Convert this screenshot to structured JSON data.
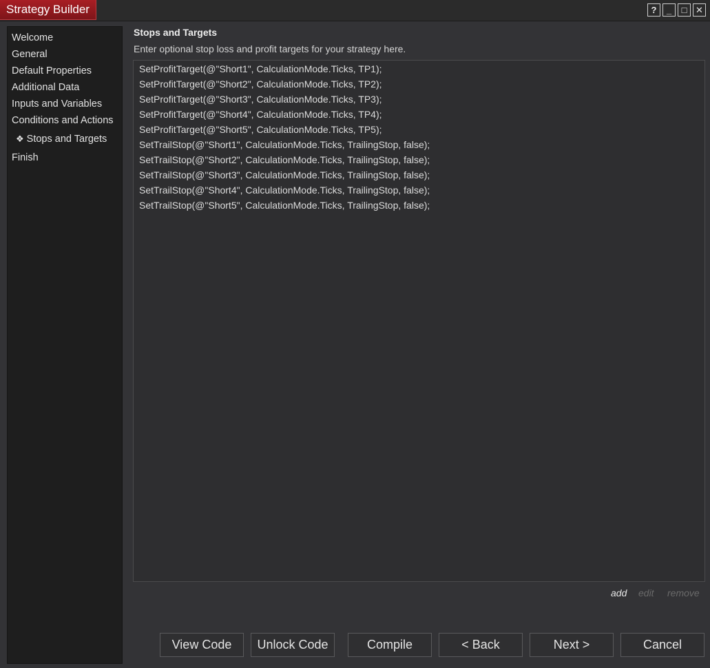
{
  "window": {
    "title": "Strategy Builder",
    "controls": {
      "help": "?",
      "minimize": "_",
      "maximize": "□",
      "close": "✕"
    }
  },
  "sidebar": {
    "items": [
      {
        "label": "Welcome",
        "active": false
      },
      {
        "label": "General",
        "active": false
      },
      {
        "label": "Default Properties",
        "active": false
      },
      {
        "label": "Additional Data",
        "active": false
      },
      {
        "label": "Inputs and Variables",
        "active": false
      },
      {
        "label": "Conditions and Actions",
        "active": false
      },
      {
        "label": "Stops and Targets",
        "active": true,
        "bullet": "❖"
      },
      {
        "label": "Finish",
        "active": false
      }
    ]
  },
  "main": {
    "title": "Stops and Targets",
    "description": "Enter optional stop loss and profit targets for your strategy here.",
    "code_lines": [
      "SetProfitTarget(@\"Short1\", CalculationMode.Ticks, TP1);",
      "SetProfitTarget(@\"Short2\", CalculationMode.Ticks, TP2);",
      "SetProfitTarget(@\"Short3\", CalculationMode.Ticks, TP3);",
      "SetProfitTarget(@\"Short4\", CalculationMode.Ticks, TP4);",
      "SetProfitTarget(@\"Short5\", CalculationMode.Ticks, TP5);",
      "SetTrailStop(@\"Short1\", CalculationMode.Ticks, TrailingStop, false);",
      "SetTrailStop(@\"Short2\", CalculationMode.Ticks, TrailingStop, false);",
      "SetTrailStop(@\"Short3\", CalculationMode.Ticks, TrailingStop, false);",
      "SetTrailStop(@\"Short4\", CalculationMode.Ticks, TrailingStop, false);",
      "SetTrailStop(@\"Short5\", CalculationMode.Ticks, TrailingStop, false);"
    ],
    "actions": {
      "add": "add",
      "edit": "edit",
      "remove": "remove"
    }
  },
  "footer": {
    "view_code": "View Code",
    "unlock_code": "Unlock Code",
    "compile": "Compile",
    "back": "< Back",
    "next": "Next >",
    "cancel": "Cancel"
  },
  "colors": {
    "accent": "#9b1b21",
    "background": "#333336",
    "sidebar": "#1e1e1e"
  }
}
